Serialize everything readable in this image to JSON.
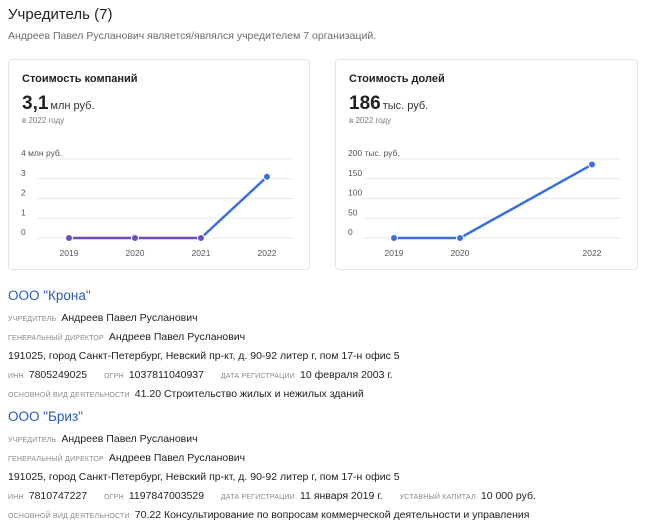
{
  "header": {
    "title": "Учредитель (7)",
    "subtitle": "Андреев Павел Русланович является/являлся учредителем 7 организаций."
  },
  "cards": [
    {
      "title": "Стоимость компаний",
      "value": "3,1",
      "unit": "млн руб.",
      "period": "в 2022 году"
    },
    {
      "title": "Стоимость долей",
      "value": "186",
      "unit": "тыс. руб.",
      "period": "в 2022 году"
    }
  ],
  "colors": {
    "accent_line": "#3b6fe0",
    "muted_line": "#6a4fc0",
    "link": "#2a5bb7"
  },
  "chart_data": [
    {
      "type": "line",
      "title": "Стоимость компаний",
      "categories": [
        "2019",
        "2020",
        "2021",
        "2022"
      ],
      "values": [
        0,
        0,
        0,
        3.1
      ],
      "y_ticks": [
        "0",
        "1",
        "2",
        "3",
        "4 млн руб."
      ],
      "ylim": [
        0,
        4
      ],
      "grid": true,
      "series_colors": [
        "#6a4fc0",
        "#6a4fc0",
        "#3b6fe0"
      ]
    },
    {
      "type": "line",
      "title": "Стоимость долей",
      "x": [
        2019,
        2020,
        2022
      ],
      "categories": [
        "2019",
        "2020",
        "2022"
      ],
      "values": [
        0,
        0,
        186
      ],
      "y_ticks": [
        "0",
        "50",
        "100",
        "150",
        "200 тыс. руб."
      ],
      "ylim": [
        0,
        200
      ],
      "grid": true,
      "series_colors": [
        "#3b6fe0"
      ]
    }
  ],
  "organizations": [
    {
      "name": "ООО \"Крона\"",
      "founder_label": "Учредитель",
      "founder": "Андреев Павел Русланович",
      "director_label": "Генеральный директор",
      "director": "Андреев Павел Русланович",
      "address": "191025, город Санкт-Петербург, Невский пр-кт, д. 90-92 литер г, пом 17-н офис 5",
      "inn_label": "ИНН",
      "inn": "7805249025",
      "ogrn_label": "ОГРН",
      "ogrn": "1037811040937",
      "reg_label": "Дата регистрации",
      "reg_date": "10 февраля 2003 г.",
      "activity_label": "Основной вид деятельности",
      "activity": "41.20 Строительство жилых и нежилых зданий"
    },
    {
      "name": "ООО \"Бриз\"",
      "founder_label": "Учредитель",
      "founder": "Андреев Павел Русланович",
      "director_label": "Генеральный директор",
      "director": "Андреев Павел Русланович",
      "address": "191025, город Санкт-Петербург, Невский пр-кт, д. 90-92 литер г, пом 17-н офис 5",
      "inn_label": "ИНН",
      "inn": "7810747227",
      "ogrn_label": "ОГРН",
      "ogrn": "1197847003529",
      "reg_label": "Дата регистрации",
      "reg_date": "11 января 2019 г.",
      "capital_label": "Уставный капитал",
      "capital": "10 000 руб.",
      "activity_label": "Основной вид деятельности",
      "activity": "70.22 Консультирование по вопросам коммерческой деятельности и управления"
    }
  ]
}
